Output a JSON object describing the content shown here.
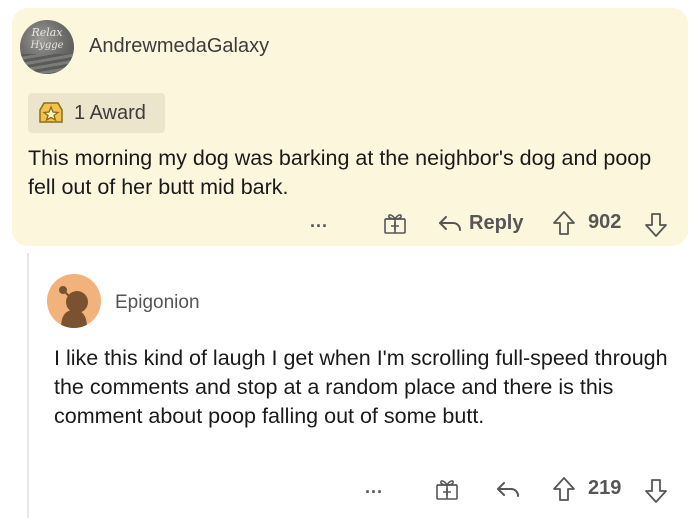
{
  "comment1": {
    "avatar_text_line1": "Relax",
    "avatar_text_line2": "Hygge",
    "username": "AndrewmedaGalaxy",
    "award_label": "1 Award",
    "body": "This morning my dog was barking at the neighbor's dog and poop fell out of her butt mid bark.",
    "more_label": "...",
    "reply_label": "Reply",
    "vote_count": "902"
  },
  "comment2": {
    "username": "Epigonion",
    "body": "I like this kind of laugh I get when I'm scrolling full-speed through the comments and stop at a random place and there is this comment about poop falling out of some butt.",
    "more_label": "...",
    "vote_count": "219"
  },
  "colors": {
    "highlight_bg": "#fcf6dc",
    "award_chip_bg": "#ece5cb",
    "avatar2_bg": "#f2b27c",
    "text": "#1a1a1b",
    "muted": "#565656"
  },
  "icons": {
    "award": "award-star-icon",
    "gift": "gift-icon",
    "reply": "reply-arrow-icon",
    "upvote": "upvote-arrow-icon",
    "downvote": "downvote-arrow-icon",
    "more": "more-dots-icon"
  }
}
